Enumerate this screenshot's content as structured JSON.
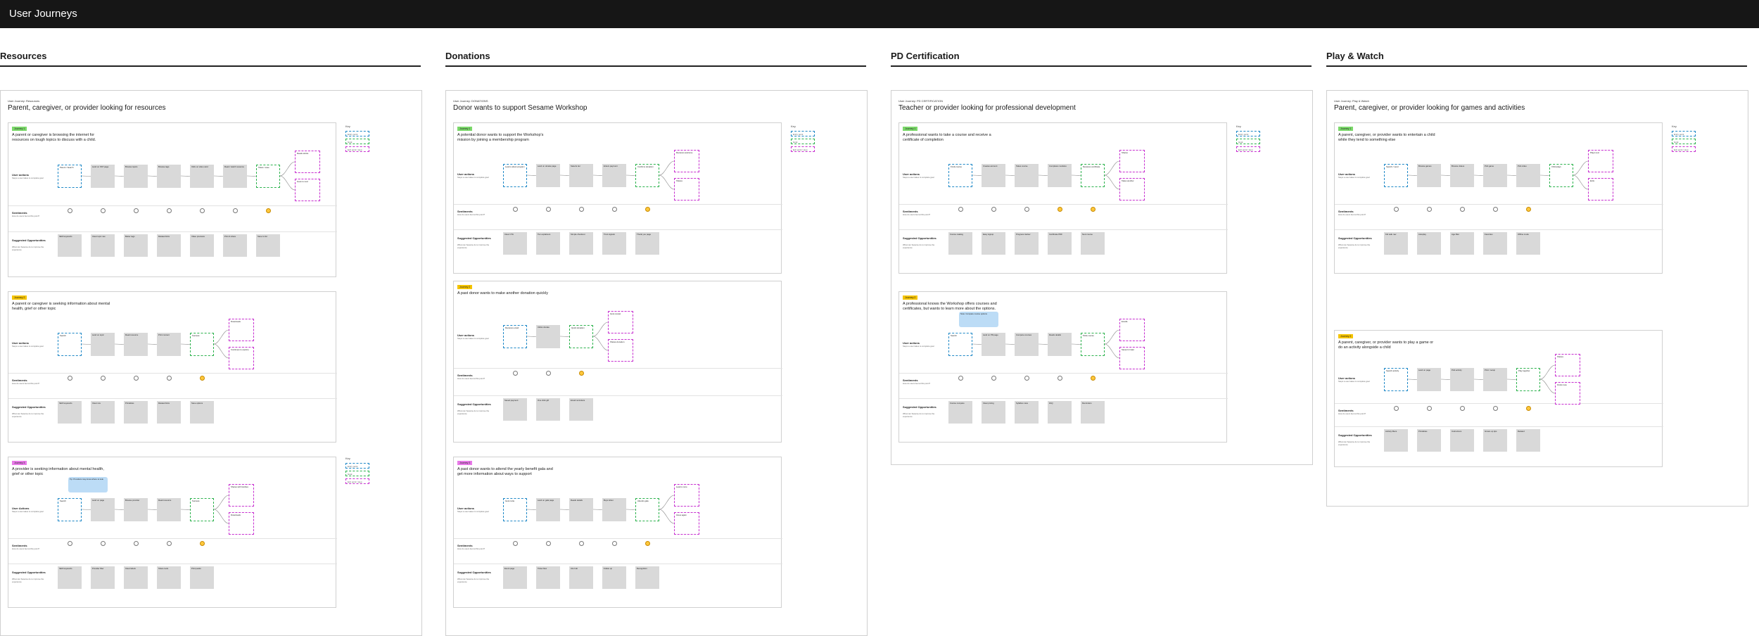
{
  "header": {
    "title": "User Journeys"
  },
  "legend": {
    "head": "Key",
    "items": [
      "Entry point",
      "Goal",
      "Exit point / step"
    ]
  },
  "sections": [
    {
      "title": "Resources",
      "board_label": "User Journey: Resources",
      "board_title": "Parent, caregiver, or provider looking for resources",
      "journeys": [
        {
          "tag": "Journey 1",
          "tag_color": "#7bd96a",
          "desc": "A parent or caregiver is browsing the internet for resources on tough topics to discuss with a child.",
          "labels": {
            "actions": "User actions",
            "actions_sub": "Steps a user takes to complete goal",
            "sentiments": "Sentiments",
            "sentiments_sub": "How do users feel at this point?",
            "opps": "Suggested Opportunities",
            "opps_sub": "What can Sesame do to improve the experience"
          },
          "actions": [
            "Parent / Search",
            "Land on SST page",
            "Browse topics",
            "Browse tags",
            "Click on video card",
            "Read / watch resource",
            "Share / save",
            "Reads article",
            "Goes to next"
          ],
          "sentiments": [
            0,
            0,
            0,
            0,
            0,
            0,
            1
          ],
          "opps": [
            "SEO keywords",
            "Clear topic nav",
            "Better tags",
            "Related links",
            "Video previews",
            "Print & share",
            "Save to list"
          ]
        },
        {
          "tag": "Journey 2",
          "tag_color": "#f5c400",
          "desc": "A parent or caregiver is seeking information about mental health, grief or other topic",
          "labels": {
            "actions": "User actions",
            "actions_sub": "Steps a user takes to complete goal",
            "sentiments": "Sentiments",
            "sentiments_sub": "How do users feel at this point?",
            "opps": "Suggested Opportunities",
            "opps_sub": "What can Sesame do to improve the experience"
          },
          "actions": [
            "Search",
            "Land on topic",
            "Read resource",
            "Print content",
            "Success",
            "Downloads",
            "Continues to explore"
          ],
          "sentiments": [
            0,
            0,
            0,
            0,
            1
          ],
          "opps": [
            "SEO keywords",
            "Clear nav",
            "Printables",
            "Related links",
            "Save options"
          ]
        },
        {
          "tag": "Journey 3",
          "tag_color": "#e879e8",
          "desc": "A provider is seeking information about mental health, grief or other topic",
          "labels": {
            "actions": "User Actions",
            "actions_sub": "Steps a user takes to complete goal",
            "sentiments": "Sentiments",
            "sentiments_sub": "How do users feel at this point?",
            "opps": "Suggested Opportunities",
            "opps_sub": "What can Sesame do to improve the experience"
          },
          "note": "Tip: Providers may know where to look",
          "actions": [
            "Search",
            "Land on page",
            "Browse provider",
            "Read resource",
            "Success",
            "Shares with families",
            "Downloads"
          ],
          "sentiments": [
            0,
            0,
            0,
            0,
            1
          ],
          "opps": [
            "SEO keywords",
            "Provider filter",
            "Clear labels",
            "Share tools",
            "Print packs"
          ]
        }
      ]
    },
    {
      "title": "Donations",
      "board_label": "User Journey: DONATIONS",
      "board_title": "Donor wants to support Sesame Workshop",
      "journeys": [
        {
          "tag": "Journey 1",
          "tag_color": "#7bd96a",
          "desc": "A potential donor wants to support the Workshop's mission by joining a membership program",
          "labels": {
            "actions": "User actions",
            "actions_sub": "Steps a user takes to complete goal",
            "sentiments": "Sentiments",
            "sentiments_sub": "How do users feel at this point?",
            "opps": "Suggested Opportunities",
            "opps_sub": "What can Sesame do to improve the experience"
          },
          "actions": [
            "Learns about program",
            "Land on donate page",
            "Selects tier",
            "Enters payment",
            "Confirms donation",
            "Receives welcome",
            "Shares"
          ],
          "sentiments": [
            0,
            0,
            0,
            0,
            1
          ],
          "opps": [
            "Clear CTA",
            "Tier explainers",
            "Simple checkout",
            "Trust signals",
            "Thank you page"
          ]
        },
        {
          "tag": "Journey 2",
          "tag_color": "#f5c400",
          "desc": "A past donor wants to make another donation quickly",
          "labels": {
            "actions": "User actions",
            "actions_sub": "Steps a user takes to complete goal",
            "sentiments": "Sentiments",
            "sentiments_sub": "How do users feel at this point?",
            "opps": "Suggested Opportunities",
            "opps_sub": "What can Sesame do to improve the experience"
          },
          "actions": [
            "Receives email",
            "Clicks donate",
            "Quick donation",
            "Gets receipt",
            "Shares donation"
          ],
          "sentiments": [
            0,
            0,
            1
          ],
          "opps": [
            "Saved payment",
            "One click gift",
            "Email reminders"
          ]
        },
        {
          "tag": "Journey 3",
          "tag_color": "#e879e8",
          "desc": "A past donor wants to attend the yearly benefit gala and get more information about ways to support",
          "labels": {
            "actions": "User actions",
            "actions_sub": "Steps a user takes to complete goal",
            "sentiments": "Sentiments",
            "sentiments_sub": "How do users feel at this point?",
            "opps": "Suggested Opportunities",
            "opps_sub": "What can Sesame do to improve the experience"
          },
          "actions": [
            "Gets invite",
            "Land on gala page",
            "Reads details",
            "Buys ticket",
            "Attends gala",
            "Learns more",
            "Gives again"
          ],
          "sentiments": [
            0,
            0,
            0,
            0,
            1
          ],
          "opps": [
            "Event page",
            "Ticket flow",
            "Info hub",
            "Follow up",
            "Recognition"
          ]
        }
      ]
    },
    {
      "title": "PD Certification",
      "board_label": "User Journey: PD CERTIFICATION",
      "board_title": "Teacher or provider looking for professional development",
      "journeys": [
        {
          "tag": "Journey 1",
          "tag_color": "#7bd96a",
          "desc": "A professional wants to take a course and receive a certificate of completion",
          "labels": {
            "actions": "User actions",
            "actions_sub": "Steps a user takes to complete goal",
            "sentiments": "Sentiments",
            "sentiments_sub": "How do users feel at this point?",
            "opps": "Suggested Opportunities",
            "opps_sub": "What can Sesame do to improve the experience"
          },
          "actions": [
            "Finds course",
            "Creates account",
            "Takes course",
            "Completes modules",
            "Receives certificate",
            "Shares",
            "Takes another"
          ],
          "sentiments": [
            0,
            0,
            0,
            1,
            1
          ],
          "opps": [
            "Course catalog",
            "Easy signup",
            "Progress tracker",
            "Certificate PDF",
            "Next course"
          ]
        },
        {
          "tag": "Journey 2",
          "tag_color": "#f5c400",
          "desc": "A professional knows the Workshop offers courses and certificates, but wants to learn more about the options.",
          "labels": {
            "actions": "User actions",
            "actions_sub": "Steps a user takes to complete goal",
            "sentiments": "Sentiments",
            "sentiments_sub": "How do users feel at this point?",
            "opps": "Suggested Opportunities",
            "opps_sub": "What can Sesame do to improve the experience"
          },
          "note": "Note: Compare course options",
          "actions": [
            "Search",
            "Land on PD page",
            "Compare courses",
            "Reads details",
            "Picks course",
            "Enrolls",
            "Saves for later"
          ],
          "sentiments": [
            0,
            0,
            0,
            0,
            1
          ],
          "opps": [
            "Course compare",
            "Clear pricing",
            "Syllabus view",
            "FAQ",
            "Reminders"
          ]
        }
      ]
    },
    {
      "title": "Play & Watch",
      "board_label": "User Journey: Play & Watch",
      "board_title": "Parent, caregiver, or provider looking for games and activities",
      "journeys": [
        {
          "tag": "Journey 1",
          "tag_color": "#7bd96a",
          "desc": "A parent, caregiver, or provider wants to entertain a child while they tend to something else",
          "labels": {
            "actions": "User actions",
            "actions_sub": "Steps a user takes to complete goal",
            "sentiments": "Sentiments",
            "sentiments_sub": "How do users feel at this point?",
            "opps": "Suggested Opportunities",
            "opps_sub": "What can Sesame do to improve the experience"
          },
          "actions": [
            "Search / Land",
            "Browse games",
            "Browse videos",
            "Pick game",
            "Pick video",
            "Child plays",
            "Plays next",
            "Exits"
          ],
          "sentiments": [
            0,
            0,
            0,
            0,
            1
          ],
          "opps": [
            "Kid safe nav",
            "Autoplay",
            "Age filter",
            "Favorites",
            "Offline mode"
          ]
        },
        {
          "tag": "Journey 2",
          "tag_color": "#f5c400",
          "desc": "A parent, caregiver, or provider wants to play a game or do an activity alongside a child",
          "labels": {
            "actions": "User actions",
            "actions_sub": "Steps a user takes to complete goal",
            "sentiments": "Sentiments",
            "sentiments_sub": "How do users feel at this point?",
            "opps": "Suggested Opportunities",
            "opps_sub": "What can Sesame do to improve the experience"
          },
          "actions": [
            "Search activity",
            "Land on page",
            "Pick activity",
            "Print / setup",
            "Play together",
            "Shares",
            "Finds more"
          ],
          "sentiments": [
            0,
            0,
            0,
            0,
            1
          ],
          "opps": [
            "Activity filters",
            "Printables",
            "Instructions",
            "Grown-up tips",
            "Related"
          ]
        }
      ]
    }
  ]
}
